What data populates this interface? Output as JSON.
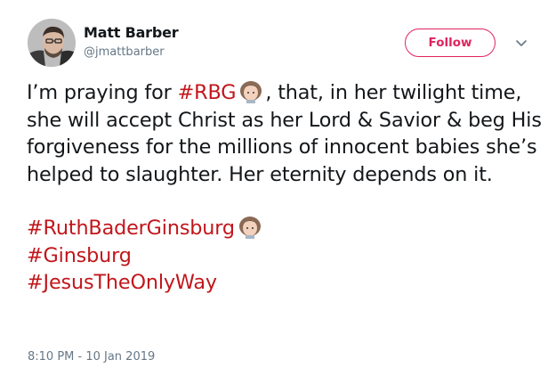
{
  "author": {
    "name": "Matt Barber",
    "handle": "@jmattbarber"
  },
  "actions": {
    "follow_label": "Follow"
  },
  "tweet": {
    "line1_prefix": "I’m praying for ",
    "tag_rbg": "#RBG",
    "line1_rest": ", that, in her twilight time, she will accept Christ as her Lord & Savior & beg His forgiveness for the millions of innocent babies she’s helped to slaughter. Her eternity depends on it.",
    "hashtags": [
      "#RuthBaderGinsburg",
      "#Ginsburg",
      "#JesusTheOnlyWay"
    ]
  },
  "timestamp": "8:10 PM - 10 Jan 2019",
  "colors": {
    "hashtag": "#c1161b",
    "follow_border": "#e0245e",
    "muted_text": "#657786"
  },
  "icons": {
    "menu": "chevron-down-icon",
    "emoji": "older-woman-emoji"
  }
}
